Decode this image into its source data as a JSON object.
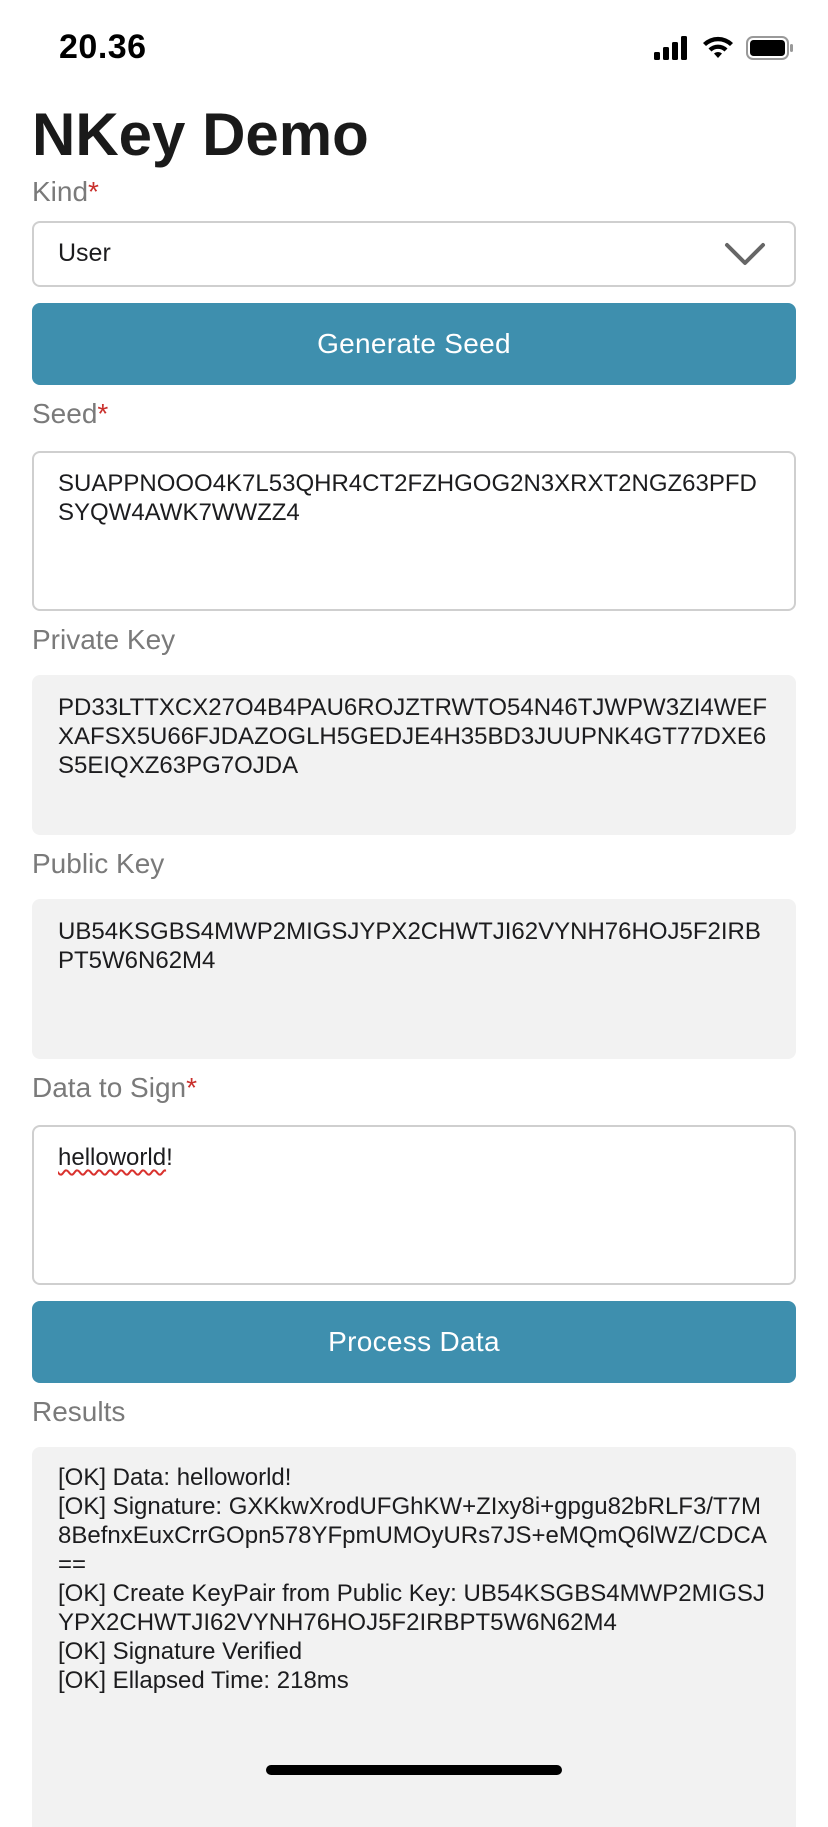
{
  "status_bar": {
    "time": "20.36",
    "icons": [
      "signal-icon",
      "wifi-icon",
      "battery-icon"
    ]
  },
  "page_title": "NKey Demo",
  "kind": {
    "label": "Kind",
    "required_marker": "*",
    "selected_value": "User"
  },
  "generate_button": {
    "label": "Generate Seed"
  },
  "seed": {
    "label": "Seed",
    "required_marker": "*",
    "value": "SUAPPNOOO4K7L53QHR4CT2FZHGOG2N3XRXT2NGZ63PFDSYQW4AWK7WWZZ4"
  },
  "private_key": {
    "label": "Private Key",
    "value": "PD33LTTXCX27O4B4PAU6ROJZTRWTO54N46TJWPW3ZI4WEFXAFSX5U66FJDAZOGLH5GEDJE4H35BD3JUUPNK4GT77DXE6S5EIQXZ63PG7OJDA"
  },
  "public_key": {
    "label": "Public Key",
    "value": "UB54KSGBS4MWP2MIGSJYPX2CHWTJI62VYNH76HOJ5F2IRBPT5W6N62M4"
  },
  "data_to_sign": {
    "label": "Data to Sign",
    "required_marker": "*",
    "value_word": "helloworld",
    "value_suffix": "!"
  },
  "process_button": {
    "label": "Process Data"
  },
  "results": {
    "label": "Results",
    "lines": [
      "[OK] Data: helloworld!",
      "[OK] Signature: GXKkwXrodUFGhKW+ZIxy8i+gpgu82bRLF3/T7M8BefnxEuxCrrGOpn578YFpmUMOyURs7JS+eMQmQ6lWZ/CDCA==",
      "[OK] Create KeyPair from Public Key: UB54KSGBS4MWP2MIGSJYPX2CHWTJI62VYNH76HOJ5F2IRBPT5W6N62M4",
      "[OK] Signature Verified",
      "[OK] Ellapsed Time: 218ms"
    ]
  },
  "colors": {
    "accent": "#3e8fae",
    "required": "#c9302c",
    "label": "#7a7a7a",
    "readonly_bg": "#f2f2f2"
  }
}
